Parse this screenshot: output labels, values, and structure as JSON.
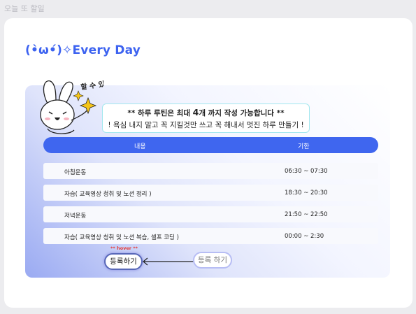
{
  "page_label": "오늘 또 할일",
  "logo": {
    "text": "(•̀ω•́)✧Every Day"
  },
  "mascot": {
    "speech": "할 수 있어!"
  },
  "notice": {
    "line1_pre": "** 하루 루틴은 최대 ",
    "line1_num": "4",
    "line1_post": "개 까지 작성 가능합니다 **",
    "line2": "! 욕심 내지 말고 꼭 지킬것만 쓰고 꼭 해내서 멋진 하루 만들기 !"
  },
  "table": {
    "headers": {
      "task": "내용",
      "time": "기한"
    },
    "rows": [
      {
        "task": "아침운동",
        "time": "06:30 ~ 07:30"
      },
      {
        "task": "자습( 교육영상 청취 및 노션 정리 )",
        "time": "18:30 ~ 20:30"
      },
      {
        "task": "저녁운동",
        "time": "21:50 ~ 22:50"
      },
      {
        "task": "자습( 교육영상 청취 및 노션 복습, 셀프 코딩 )",
        "time": "00:00 ~ 2:30"
      }
    ]
  },
  "buttons": {
    "hover_note": "** hover **",
    "register_hover_label": "등록하기",
    "register_label": "등록 하기"
  },
  "colors": {
    "accent": "#3f66ef",
    "logo": "#3d63f0",
    "hover_note": "#e53935",
    "notice_border": "#a3e7ee"
  }
}
